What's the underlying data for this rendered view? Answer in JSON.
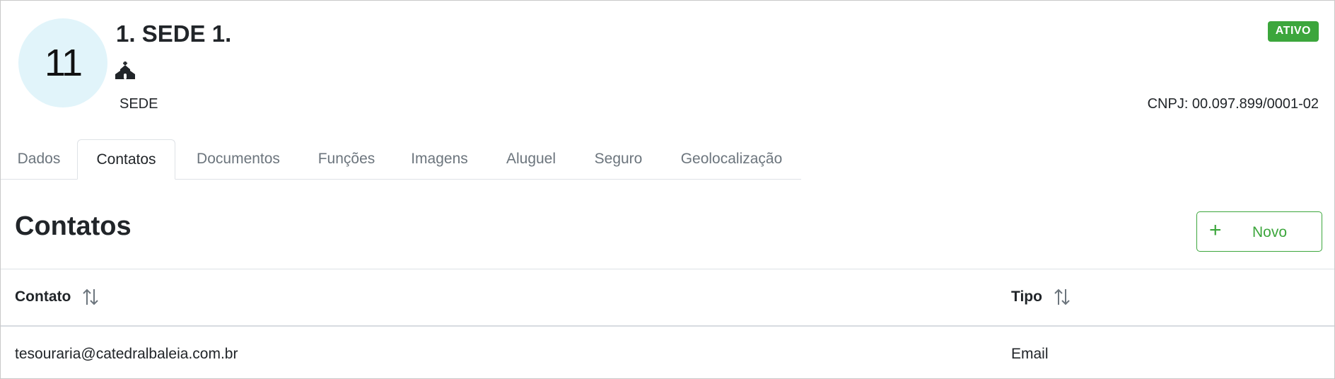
{
  "header": {
    "avatar_text": "11",
    "title": "1. SEDE 1.",
    "icon": "church-building-icon",
    "subtitle": "SEDE",
    "status": "ATIVO",
    "cnpj": "CNPJ: 00.097.899/0001-02"
  },
  "tabs": [
    {
      "label": "Dados",
      "active": false
    },
    {
      "label": "Contatos",
      "active": true
    },
    {
      "label": "Documentos",
      "active": false
    },
    {
      "label": "Funções",
      "active": false
    },
    {
      "label": "Imagens",
      "active": false
    },
    {
      "label": "Aluguel",
      "active": false
    },
    {
      "label": "Seguro",
      "active": false
    },
    {
      "label": "Geolocalização",
      "active": false
    }
  ],
  "section": {
    "title": "Contatos",
    "new_button": {
      "icon": "plus-icon",
      "label": "Novo"
    }
  },
  "table": {
    "columns": [
      {
        "label": "Contato",
        "sort_icon": "sort-icon"
      },
      {
        "label": "Tipo",
        "sort_icon": "sort-icon"
      }
    ],
    "rows": [
      [
        "tesouraria@catedralbaleia.com.br",
        "Email"
      ]
    ]
  },
  "colors": {
    "accent_green": "#3ca63c",
    "avatar_bg": "#e1f4fa",
    "muted_text": "#6c757d"
  }
}
